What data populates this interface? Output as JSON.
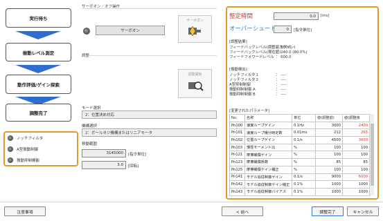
{
  "flow": {
    "steps": [
      "実行待ち",
      "振動レベル測定",
      "動作評価/ゲイン探索",
      "調整完了"
    ],
    "options": [
      "ノッチフィルタ",
      "A型振動制御",
      "振動抑制機能"
    ]
  },
  "servo": {
    "section_title": "サーボオン／オフ操作",
    "status_button": "サーボオン",
    "icon_button_label": "サーボオン"
  },
  "adjust": {
    "section_title": "調整",
    "icon_button_label": "調整開始",
    "mode_label": "モード選択",
    "mode_value": "2：位置決め対応",
    "mechanism_label": "機構選択",
    "mechanism_value": "2：ボールネジ機構またはリニアモータ",
    "range_label": "移動範囲",
    "range_value": "3145000",
    "range_unit": "[指令単位]",
    "rev_value": "3.0",
    "rev_unit": "[回転]"
  },
  "right": {
    "settling_label": "整定時間",
    "settling_value": "0.0",
    "settling_unit": "[ms]",
    "overshoot_label": "オーバーシュート",
    "overshoot_value": "0",
    "overshoot_unit": "[指令単位]",
    "results_title": "[調整結果]",
    "results": [
      {
        "label": "フィードバックレベル(調整最大ゲイン)",
        "value": "： 300.0"
      },
      {
        "label": "フィードバックレベル(現在値)",
        "value": "： 240.0 (80.0%)"
      },
      {
        "label": "フィードフォワードレベル",
        "value": "： 600.0"
      }
    ],
    "detect_title": "[振動検出]",
    "detect": [
      {
        "label": "ノッチフィルタ１",
        "value": "： ----"
      },
      {
        "label": "ノッチフィルタ２",
        "value": "： ----"
      },
      {
        "label": "A型抑制制御",
        "value": "： ----"
      },
      {
        "label": "振動抑制制御 A",
        "value": "： ----"
      },
      {
        "label": "振動抑制制御 B",
        "value": "： ----"
      }
    ],
    "changed_title": "[変更されたパラメータ]"
  },
  "table": {
    "headers": [
      "No.",
      "名称",
      "単位",
      "値(調整前)",
      "値(調整後"
    ],
    "rows": [
      [
        "Pn100",
        "速度ループゲイン",
        "0.1Hz",
        "3000",
        "2400"
      ],
      [
        "Pn101",
        "速度ループ積分時定数",
        "0.01ms",
        "212",
        "265"
      ],
      [
        "Pn102",
        "位置ループゲイン",
        "0.1/s",
        "4500",
        "3600"
      ],
      [
        "Pn103",
        "慣性モーメント比",
        "%",
        "100",
        "100"
      ],
      [
        "Pn121",
        "摩擦補償ゲイン",
        "%",
        "100",
        "100"
      ],
      [
        "Pn123",
        "摩擦補償係数",
        "%",
        "85",
        "85"
      ],
      [
        "Pn125",
        "摩擦補償ゲイン補正",
        "%",
        "100",
        "100"
      ],
      [
        "Pn141",
        "モデル追従制御ゲイン",
        "0.1/s",
        "9000",
        "6000"
      ],
      [
        "Pn142",
        "モデル追従制御ゲイン補正",
        "0.1%",
        "1000",
        "1000"
      ],
      [
        "Pn143",
        "モデル追従制御バイアス",
        "0.1%",
        "1000",
        "1000"
      ]
    ],
    "changed_rows": [
      0,
      1,
      2,
      7
    ]
  },
  "footer": {
    "notes": "注意事項",
    "prev": "< 前へ",
    "complete": "調整完了",
    "cancel": "キャンセル"
  },
  "colors": {
    "accent_orange": "#e39a2c",
    "arrow_blue": "#2f6ed0",
    "changed_red": "#e0302a",
    "title_red": "#d83838",
    "title_blue": "#3a78d0"
  }
}
